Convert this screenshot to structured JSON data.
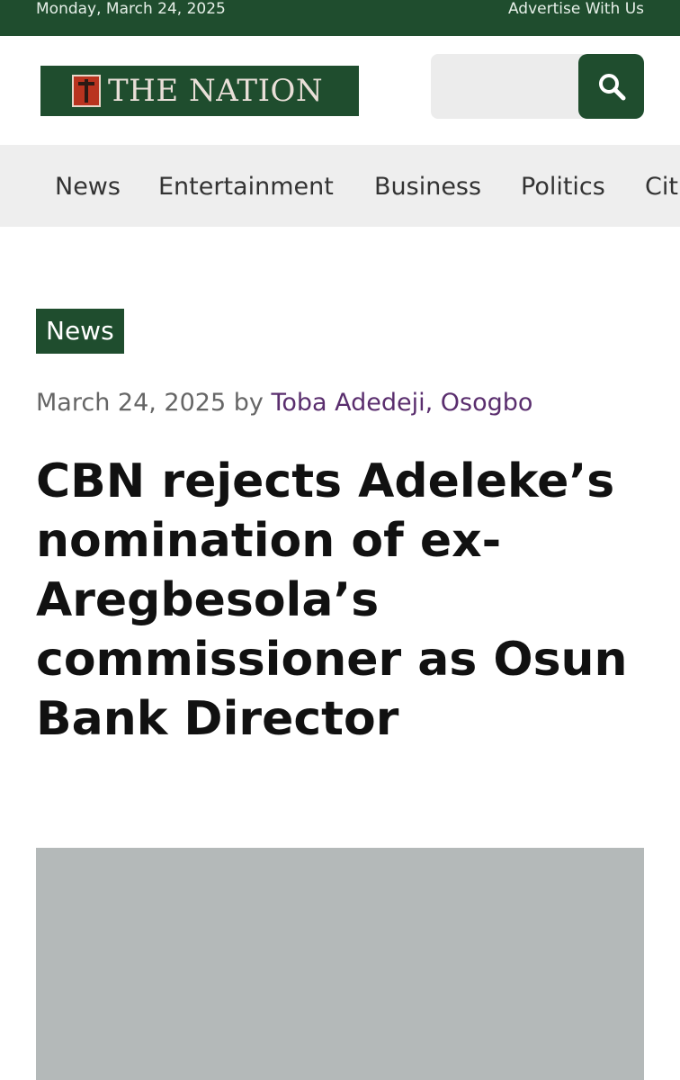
{
  "topbar": {
    "date": "Monday, March 24, 2025",
    "advertise": "Advertise With Us"
  },
  "header": {
    "logo_text": "THE NATION",
    "search": {
      "placeholder": "",
      "value": ""
    },
    "search_icon": "search-icon"
  },
  "nav": {
    "items": [
      {
        "label": "News"
      },
      {
        "label": "Entertainment"
      },
      {
        "label": "Business"
      },
      {
        "label": "Politics"
      },
      {
        "label": "Cit"
      }
    ]
  },
  "article": {
    "category": "News",
    "date": "March 24, 2025",
    "by": "by",
    "author": "Toba Adedeji, Osogbo",
    "title": "CBN rejects Adeleke’s nomination of ex-Aregbesola’s commissioner as Osun Bank Director"
  },
  "colors": {
    "brand_green": "#1f4d2e",
    "nav_bg": "#eeeeee",
    "author_purple": "#5a2e6e",
    "image_placeholder": "#b4b9b9"
  }
}
